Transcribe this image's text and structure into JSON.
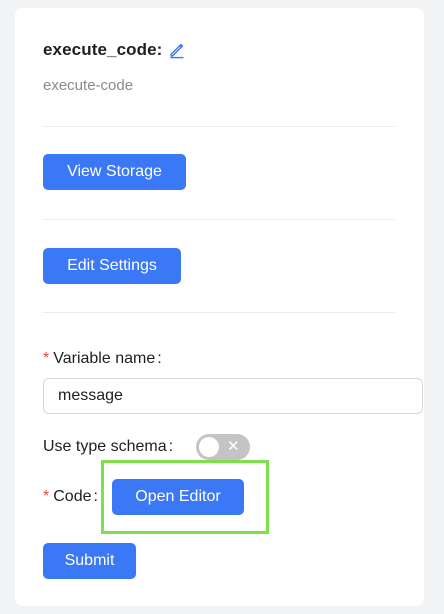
{
  "node": {
    "title": "execute_code:",
    "subtitle": "execute-code"
  },
  "buttons": {
    "view_storage": "View Storage",
    "edit_settings": "Edit Settings",
    "open_editor": "Open Editor",
    "submit": "Submit"
  },
  "form": {
    "variable_name": {
      "required_mark": "*",
      "label": "Variable name",
      "colon": ":",
      "value": "message"
    },
    "use_type_schema": {
      "label": "Use type schema",
      "colon": ":",
      "enabled": false,
      "off_glyph": "✕"
    },
    "code": {
      "required_mark": "*",
      "label": "Code",
      "colon": ":"
    }
  },
  "icons": {
    "edit": "pencil-icon"
  },
  "colors": {
    "primary": "#3b78f5",
    "required": "#e5484d",
    "highlight": "#7ee04a",
    "toggle_off": "#c4c4c4"
  }
}
